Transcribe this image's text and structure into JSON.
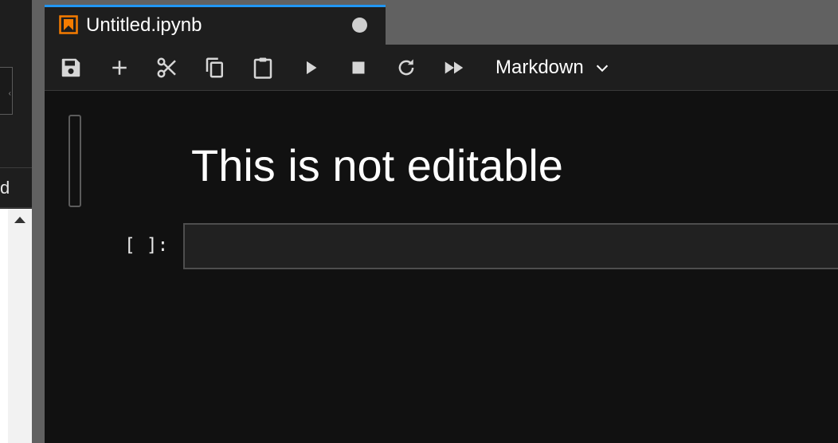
{
  "sidebar": {
    "truncated_item_text": "d"
  },
  "tab": {
    "title": "Untitled.ipynb",
    "icon": "notebook-icon",
    "accent_color": "#2196f3",
    "icon_color": "#f57c00"
  },
  "toolbar": {
    "buttons": [
      {
        "name": "save-icon"
      },
      {
        "name": "add-cell-icon"
      },
      {
        "name": "cut-icon"
      },
      {
        "name": "copy-icon"
      },
      {
        "name": "paste-icon"
      },
      {
        "name": "run-icon"
      },
      {
        "name": "stop-icon"
      },
      {
        "name": "restart-icon"
      },
      {
        "name": "run-all-icon"
      }
    ],
    "cell_type": "Markdown"
  },
  "notebook": {
    "markdown_cell": {
      "heading": "This is not editable"
    },
    "code_cell": {
      "prompt": "[ ]:",
      "value": ""
    }
  }
}
